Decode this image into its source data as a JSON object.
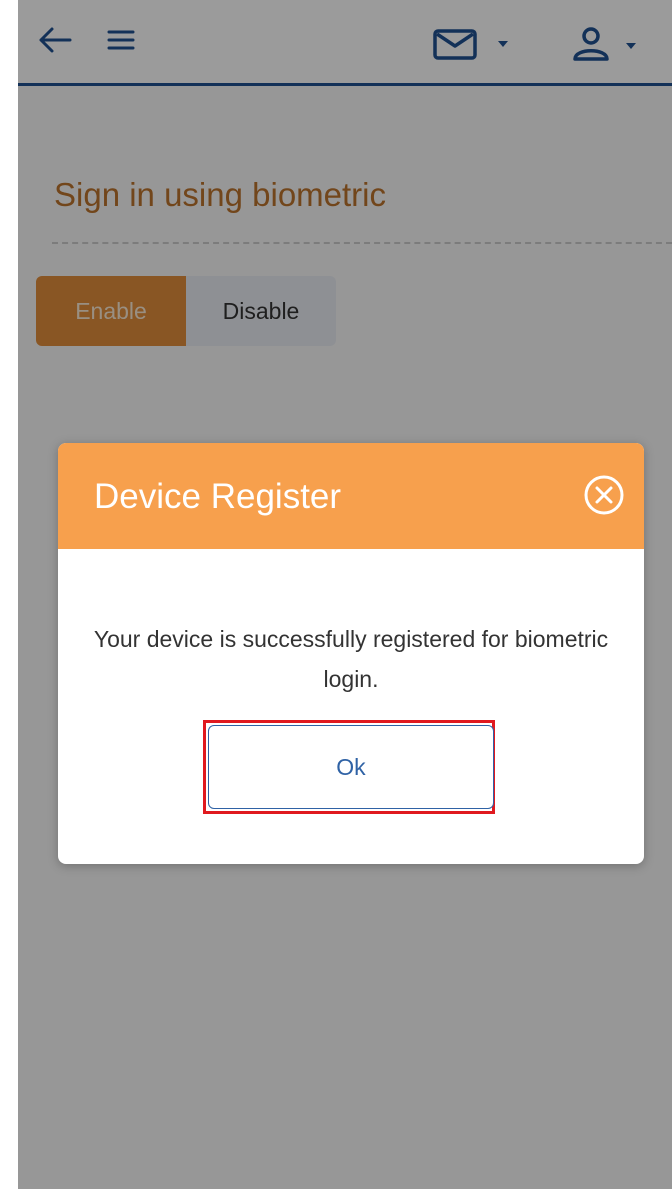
{
  "page": {
    "title": "Sign in using biometric",
    "toggle": {
      "enable_label": "Enable",
      "disable_label": "Disable",
      "selected": "Enable"
    }
  },
  "topbar": {
    "icons": [
      "back-arrow-icon",
      "menu-icon",
      "mail-icon",
      "user-icon"
    ]
  },
  "modal": {
    "title": "Device Register",
    "message": "Your device is successfully registered for biometric login.",
    "ok_label": "Ok",
    "close_icon": "close-circle-icon"
  },
  "colors": {
    "accent_orange": "#f7a04d",
    "enable_orange": "#dd8b3a",
    "title_orange": "#b9712c",
    "primary_blue": "#1f4f8f",
    "highlight_red": "#e0191f"
  }
}
